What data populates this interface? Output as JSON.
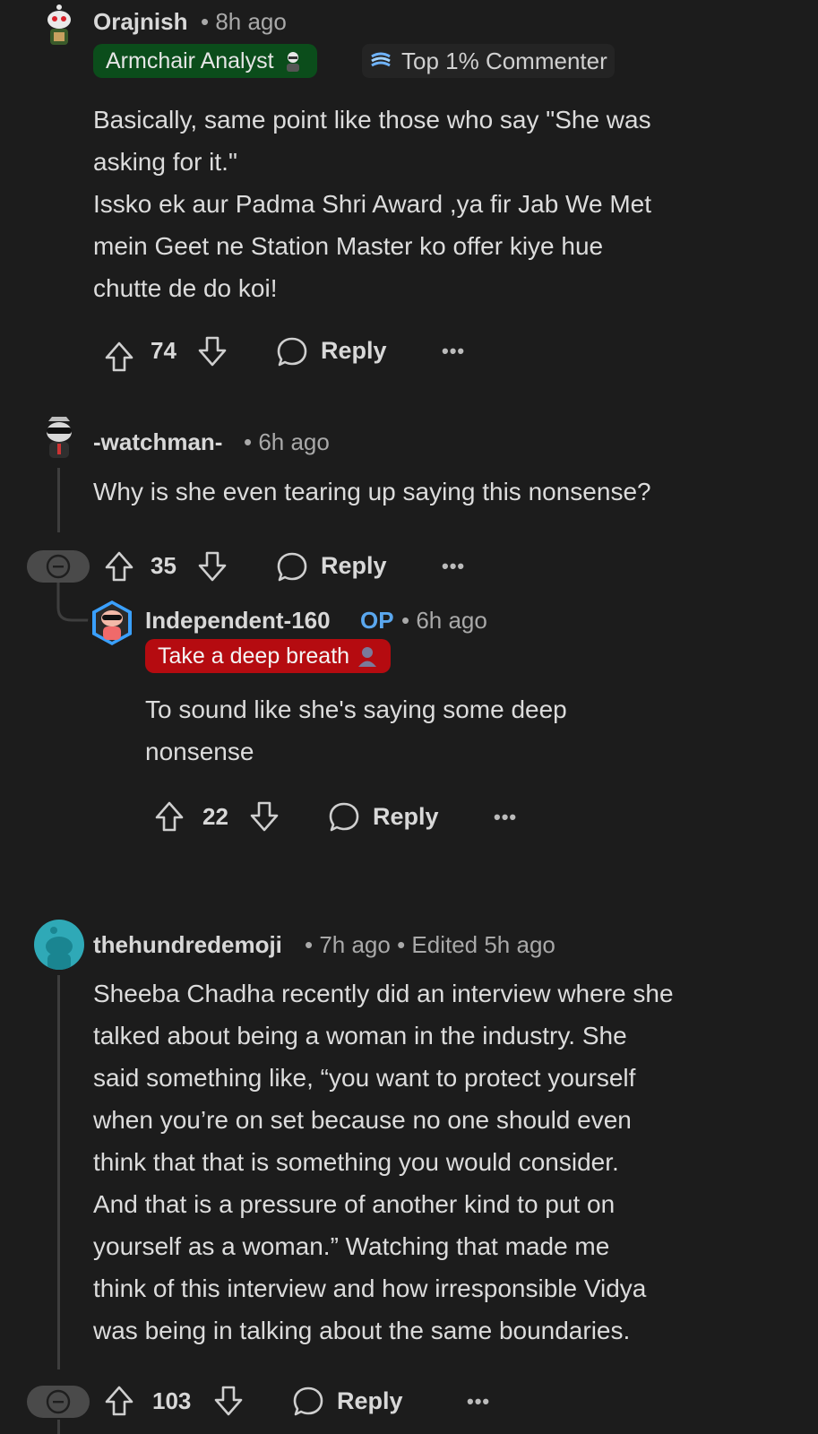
{
  "comments": [
    {
      "username": "Orajnish",
      "time": "• 8h ago",
      "flair": "Armchair Analyst",
      "badge": "Top 1% Commenter",
      "body": [
        "Basically, same point like those who say \"She was",
        "asking for it.\"",
        "Issko ek aur Padma Shri Award ,ya fir Jab We Met",
        "mein Geet ne Station Master ko offer kiye hue",
        "chutte de do koi!"
      ],
      "votes": "74",
      "reply_label": "Reply",
      "more_label": "•••"
    },
    {
      "username": "-watchman-",
      "time": "• 6h ago",
      "body": [
        "Why is she even tearing up saying this nonsense?"
      ],
      "votes": "35",
      "reply_label": "Reply",
      "more_label": "•••"
    },
    {
      "username": "Independent-160",
      "op_label": "OP",
      "time": "• 6h ago",
      "flair": "Take a deep breath",
      "body": [
        "To sound like she's saying some deep",
        "nonsense"
      ],
      "votes": "22",
      "reply_label": "Reply",
      "more_label": "•••"
    },
    {
      "username": "thehundredemoji",
      "time": "• 7h ago • Edited 5h ago",
      "body": [
        "Sheeba Chadha recently did an interview where she",
        "talked about being a woman in the industry. She",
        "said something like, “you want to protect yourself",
        "when you’re on set because no one should even",
        "think that that is something you would consider.",
        "And that is a pressure of another kind to put on",
        "yourself as a woman.” Watching that made me",
        "think of this interview and how irresponsible Vidya",
        "was being in talking about the same boundaries."
      ],
      "votes": "103",
      "reply_label": "Reply",
      "more_label": "•••"
    }
  ],
  "colors": {
    "background": "#1c1c1c",
    "op_blue": "#5aa7ee",
    "flair_green": "#0b4d1b",
    "flair_red": "#b50b10"
  }
}
